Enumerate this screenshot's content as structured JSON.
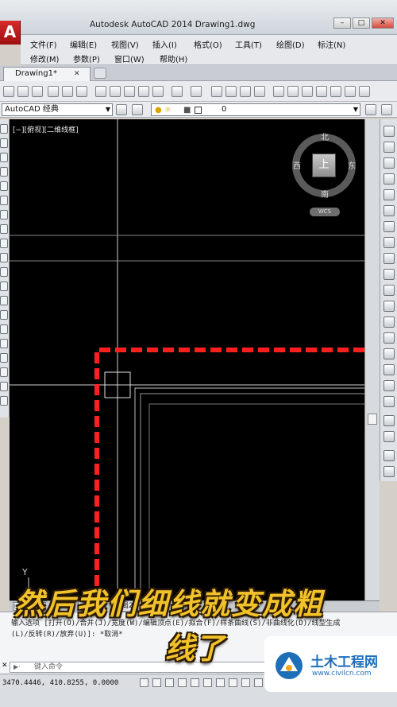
{
  "app": {
    "logo_letter": "A",
    "title": "Autodesk AutoCAD 2014    Drawing1.dwg",
    "min_glyph": "–",
    "max_glyph": "□"
  },
  "menu": {
    "row1": [
      "文件(F)",
      "编辑(E)",
      "视图(V)",
      "插入(I)",
      "格式(O)",
      "工具(T)",
      "绘图(D)",
      "标注(N)"
    ],
    "row2": [
      "修改(M)",
      "参数(P)",
      "窗口(W)",
      "帮助(H)"
    ]
  },
  "tabs": {
    "doc_label": "Drawing1*",
    "close_glyph": "✕"
  },
  "toolbar": {
    "workspace": "AutoCAD 经典",
    "layer_value": "0"
  },
  "canvas": {
    "viewport_label": "[−][俯视][二维线框]",
    "viewcube": {
      "north": "北",
      "south": "南",
      "east": "东",
      "west": "西",
      "top": "上",
      "wcs": "WCS"
    },
    "ucs_y": "Y",
    "colors": {
      "background": "#000000",
      "dashed_line": "#ff1f1f",
      "thin_line": "#cfcfcf"
    }
  },
  "layouts": {
    "tabs": [
      "模型",
      "布局1",
      "布局2"
    ]
  },
  "command": {
    "line1": "输入选项 [打开(O)/合并(J)/宽度(W)/编辑顶点(E)/拟合(F)/样条曲线(S)/非曲线化(D)/线型生成",
    "line2": "(L)/反转(R)/放弃(U)]: *取消*",
    "input_placeholder": "键入命令"
  },
  "status": {
    "coords": "3470.4446, 410.8255, 0.0000"
  },
  "caption": {
    "line1": "然后我们细线就变成粗",
    "line2": "线了"
  },
  "watermark": {
    "name": "土木工程网",
    "url": "www.civilcn.com"
  }
}
